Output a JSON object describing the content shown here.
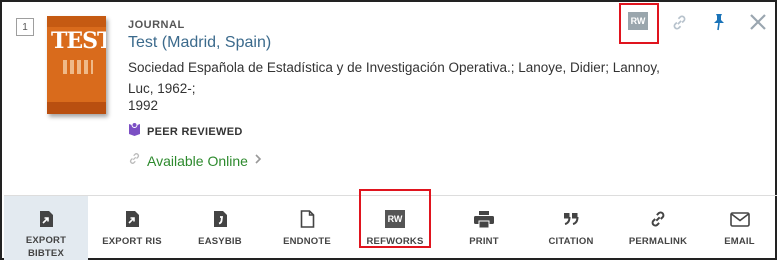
{
  "result": {
    "number": "1",
    "type": "JOURNAL",
    "title": "Test (Madrid, Spain)",
    "authors": "Sociedad Española de Estadística y de Investigación Operativa.; Lanoye, Didier; Lannoy, Luc, 1962-;",
    "year": "1992",
    "peer_reviewed": "PEER REVIEWED",
    "availability": "Available Online",
    "thumbnail_text": "TEST"
  },
  "top_actions": {
    "refworks_badge": "RW"
  },
  "actions": [
    {
      "name": "export-bibtex",
      "label": "EXPORT BIBTEX",
      "icon": "export-icon",
      "active": true
    },
    {
      "name": "export-ris",
      "label": "EXPORT RIS",
      "icon": "export-icon"
    },
    {
      "name": "easybib",
      "label": "EASYBIB",
      "icon": "easybib-icon"
    },
    {
      "name": "endnote",
      "label": "ENDNOTE",
      "icon": "document-icon"
    },
    {
      "name": "refworks",
      "label": "REFWORKS",
      "icon": "refworks-icon",
      "badge": "RW"
    },
    {
      "name": "print",
      "label": "PRINT",
      "icon": "printer-icon"
    },
    {
      "name": "citation",
      "label": "CITATION",
      "icon": "quote-icon"
    },
    {
      "name": "permalink",
      "label": "PERMALINK",
      "icon": "link-icon"
    },
    {
      "name": "email",
      "label": "EMAIL",
      "icon": "envelope-icon"
    }
  ],
  "colors": {
    "title_link": "#3b6a8c",
    "available": "#2d8a2d",
    "peer_reviewed_icon": "#7b4fc4",
    "pin": "#1a73b8",
    "highlight": "#e0141e",
    "active_action_bg": "#e3eaf0"
  }
}
